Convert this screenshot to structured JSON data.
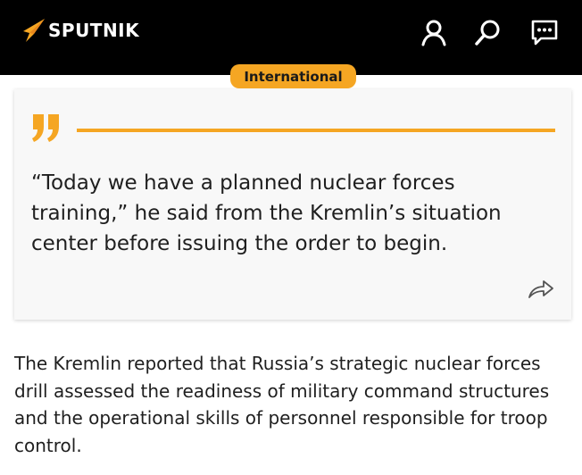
{
  "header": {
    "brand": "SPUTNIK",
    "icons": [
      "user-icon",
      "search-icon",
      "chat-icon"
    ]
  },
  "colors": {
    "header_bg": "#000000",
    "accent": "#f5a623",
    "card_bg": "#f8f8f8",
    "text": "#1f1f1f"
  },
  "tag": {
    "label": "International"
  },
  "quote": {
    "text": "“Today we have a planned nuclear forces training,” he said from the Kremlin’s situation center before issuing the order to begin."
  },
  "article": {
    "paragraph": "The Kremlin reported that Russia’s strategic nuclear forces drill assessed the readiness of military command structures and the operational skills of personnel responsible for troop control."
  }
}
